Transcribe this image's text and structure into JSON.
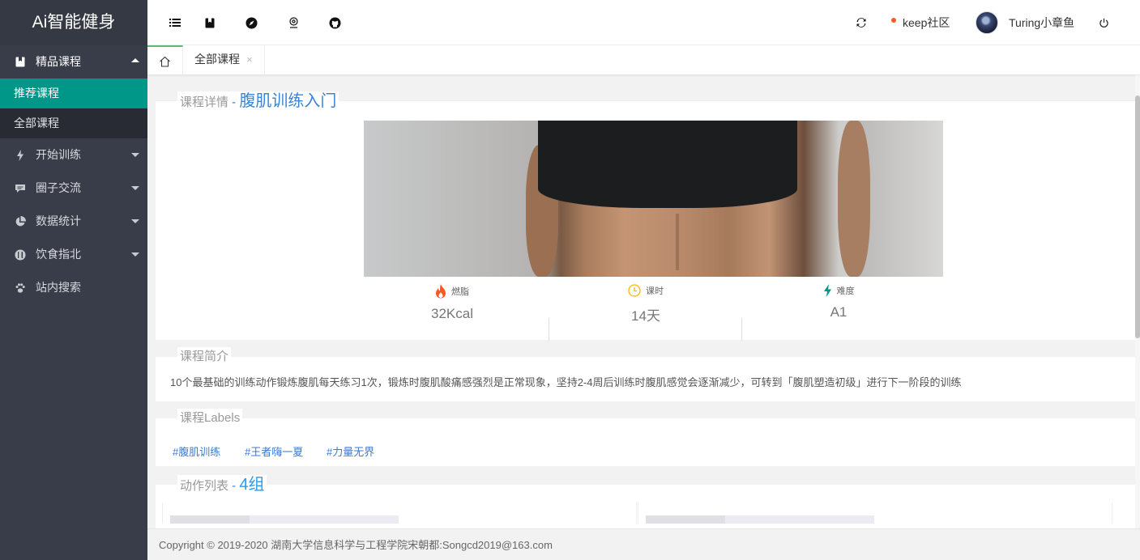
{
  "app": {
    "title": "Ai智能健身"
  },
  "sidebar": {
    "items": [
      {
        "label": "精品课程",
        "icon": "bookmark-icon",
        "open": true,
        "children": [
          {
            "label": "推荐课程",
            "active": true
          },
          {
            "label": "全部课程",
            "active": false
          }
        ]
      },
      {
        "label": "开始训练",
        "icon": "lightning-icon"
      },
      {
        "label": "圈子交流",
        "icon": "chat-bubble-icon"
      },
      {
        "label": "数据统计",
        "icon": "pie-chart-icon"
      },
      {
        "label": "饮食指北",
        "icon": "food-icon"
      },
      {
        "label": "站内搜索",
        "icon": "paw-icon"
      }
    ]
  },
  "header": {
    "left_icons": [
      "menu-icon",
      "bookmark-icon",
      "compass-icon",
      "location-icon",
      "github-icon"
    ],
    "refresh_icon": "refresh-icon",
    "community": "keep社区",
    "username": "Turing小章鱼",
    "logout_icon": "power-icon"
  },
  "tabs": {
    "home_icon": "home-icon",
    "items": [
      {
        "label": "全部课程",
        "close": "×"
      }
    ]
  },
  "course": {
    "legend_label": "课程详情",
    "legend_sep": " - ",
    "title": "腹肌训练入门",
    "stats": [
      {
        "label": "燃脂",
        "value": "32Kcal",
        "icon": "flame-icon",
        "color": "#ff5722"
      },
      {
        "label": "课时",
        "value": "14天",
        "icon": "clock-icon",
        "color": "#ffb800"
      },
      {
        "label": "难度",
        "value": "A1",
        "icon": "lightning-icon",
        "color": "#009688"
      }
    ]
  },
  "intro": {
    "legend": "课程简介",
    "text": "10个最基础的训练动作锻炼腹肌每天练习1次，锻炼时腹肌酸痛感强烈是正常现象，坚持2-4周后训练时腹肌感觉会逐渐减少，可转到「腹肌塑造初级」进行下一阶段的训练"
  },
  "labels": {
    "legend": "课程Labels",
    "items": [
      "#腹肌训练",
      "#王者嗨一夏",
      "#力量无界"
    ]
  },
  "actions": {
    "legend": "动作列表",
    "sep": " - ",
    "count": "4组"
  },
  "footer": {
    "text": "Copyright © 2019-2020 湖南大学信息科学与工程学院宋朝都:Songcd2019@163.com"
  },
  "colors": {
    "sidebar_bg": "#393d49",
    "active_green": "#009688",
    "accent_blue": "#1e9fff"
  }
}
